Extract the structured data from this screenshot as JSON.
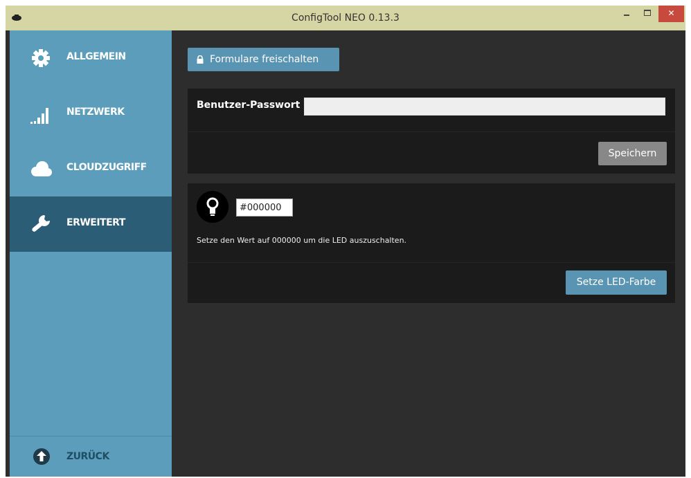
{
  "window": {
    "title": "ConfigTool NEO 0.13.3",
    "icons": [
      "app-icon",
      "minimize-icon",
      "maximize-icon",
      "close-icon"
    ]
  },
  "sidebar": {
    "items": [
      {
        "label": "ALLGEMEIN",
        "icon": "gear-icon",
        "active": false
      },
      {
        "label": "NETZWERK",
        "icon": "signal-bars-icon",
        "active": false
      },
      {
        "label": "CLOUDZUGRIFF",
        "icon": "cloud-icon",
        "active": false
      },
      {
        "label": "ERWEITERT",
        "icon": "wrench-icon",
        "active": true
      }
    ],
    "back": {
      "label": "ZURÜCK",
      "icon": "arrow-up-circle-icon"
    }
  },
  "main": {
    "unlock_button": {
      "label": "Formulare freischalten",
      "icon": "lock-icon"
    },
    "password": {
      "label": "Benutzer-Passwort",
      "value": "",
      "save_label": "Speichern"
    },
    "led": {
      "icon": "lightbulb-icon",
      "color_value": "#000000",
      "hint": "Setze den Wert auf 000000 um die LED auszuschalten.",
      "button_label": "Setze LED-Farbe"
    }
  },
  "colors": {
    "titlebar": "#d6d6a4",
    "sidebar": "#5b9dbb",
    "sidebar_active": "#2c5d76",
    "content_bg": "#2d2d2d",
    "panel_bg": "#1b1b1b",
    "accent_button": "#5994b2",
    "close_button": "#c84a3e"
  }
}
